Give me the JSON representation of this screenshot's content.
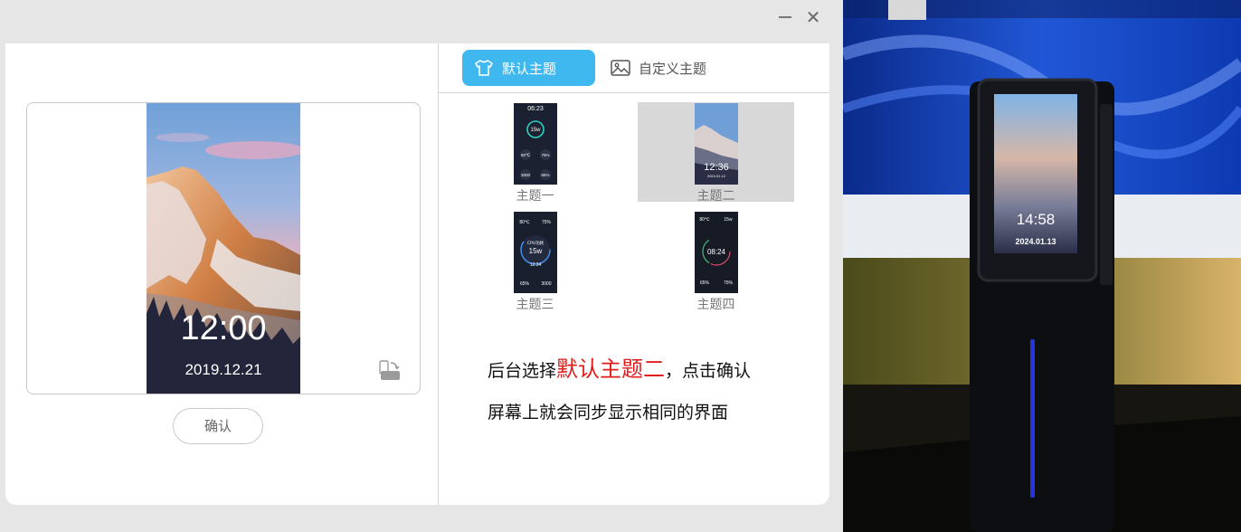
{
  "window": {
    "minimize_icon": "minimize-icon",
    "close_icon": "close-icon",
    "close_glyph": "✕"
  },
  "preview": {
    "time": "12:00",
    "date": "2019.12.21",
    "rotate_icon": "rotate-screen-icon"
  },
  "confirm_label": "确认",
  "tabs": [
    {
      "label": "默认主题",
      "icon": "tshirt-icon",
      "active": true
    },
    {
      "label": "自定义主题",
      "icon": "image-icon",
      "active": false
    }
  ],
  "themes": [
    {
      "label": "主题一",
      "selected": false,
      "thumb": {
        "time": "06:23",
        "power": "15w",
        "temp": "80℃",
        "pct1": "75%",
        "num": "3000",
        "pct2": "65%"
      }
    },
    {
      "label": "主题二",
      "selected": true,
      "thumb": {
        "time": "12:36",
        "date": "2024.01.12"
      }
    },
    {
      "label": "主题三",
      "selected": false,
      "thumb": {
        "temp": "80℃",
        "pct1": "75%",
        "cpu": "CPU功耗",
        "power": "15w",
        "time": "12:34",
        "pct2": "65%",
        "num": "3000"
      }
    },
    {
      "label": "主题四",
      "selected": false,
      "thumb": {
        "temp": "80℃",
        "power": "15w",
        "time": "08:24",
        "pct1": "65%",
        "pct2": "75%"
      }
    }
  ],
  "annotation": {
    "line1_pre": "后台选择",
    "line1_highlight": "默认主题二",
    "line1_post": "，点击确认",
    "line2": "屏幕上就会同步显示相同的界面"
  },
  "photo": {
    "device_time": "14:58",
    "device_date": "2024.01.13"
  },
  "colors": {
    "accent": "#3fb8f0",
    "highlight_text": "#e31b1b",
    "selected_bg": "#d8d8d8"
  }
}
